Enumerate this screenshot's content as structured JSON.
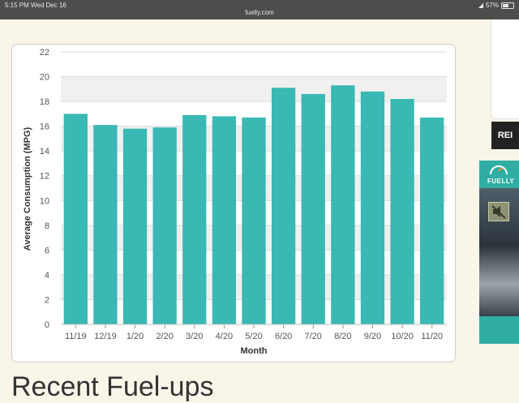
{
  "status_bar": {
    "time": "5:15 PM",
    "date": "Wed Dec 16",
    "url": "fuelly.com",
    "battery": "57%"
  },
  "colors": {
    "bar": "#3ab8b3",
    "band": "#f0f0f0",
    "grid": "#d9d9d9",
    "axis_text": "#555555",
    "page_background": "#f9f6e9",
    "ad_background": "#32ada3"
  },
  "chart_data": {
    "type": "bar",
    "categories": [
      "11/19",
      "12/19",
      "1/20",
      "2/20",
      "3/20",
      "4/20",
      "5/20",
      "6/20",
      "7/20",
      "8/20",
      "9/20",
      "10/20",
      "11/20"
    ],
    "values": [
      17.0,
      16.1,
      15.8,
      15.9,
      16.9,
      16.8,
      16.7,
      19.1,
      18.6,
      19.3,
      18.8,
      18.2,
      16.7
    ],
    "ylim": [
      0,
      22
    ],
    "yticks": [
      0,
      2,
      4,
      6,
      8,
      10,
      12,
      14,
      16,
      18,
      20,
      22
    ],
    "xlabel": "Month",
    "ylabel": "Average Consumption (MPG)",
    "grid": true
  },
  "ad": {
    "brand": "FUELLY",
    "logo_text": "REI",
    "mute_icon": "speaker-muted-icon"
  },
  "section": {
    "heading": "Recent Fuel-ups"
  }
}
